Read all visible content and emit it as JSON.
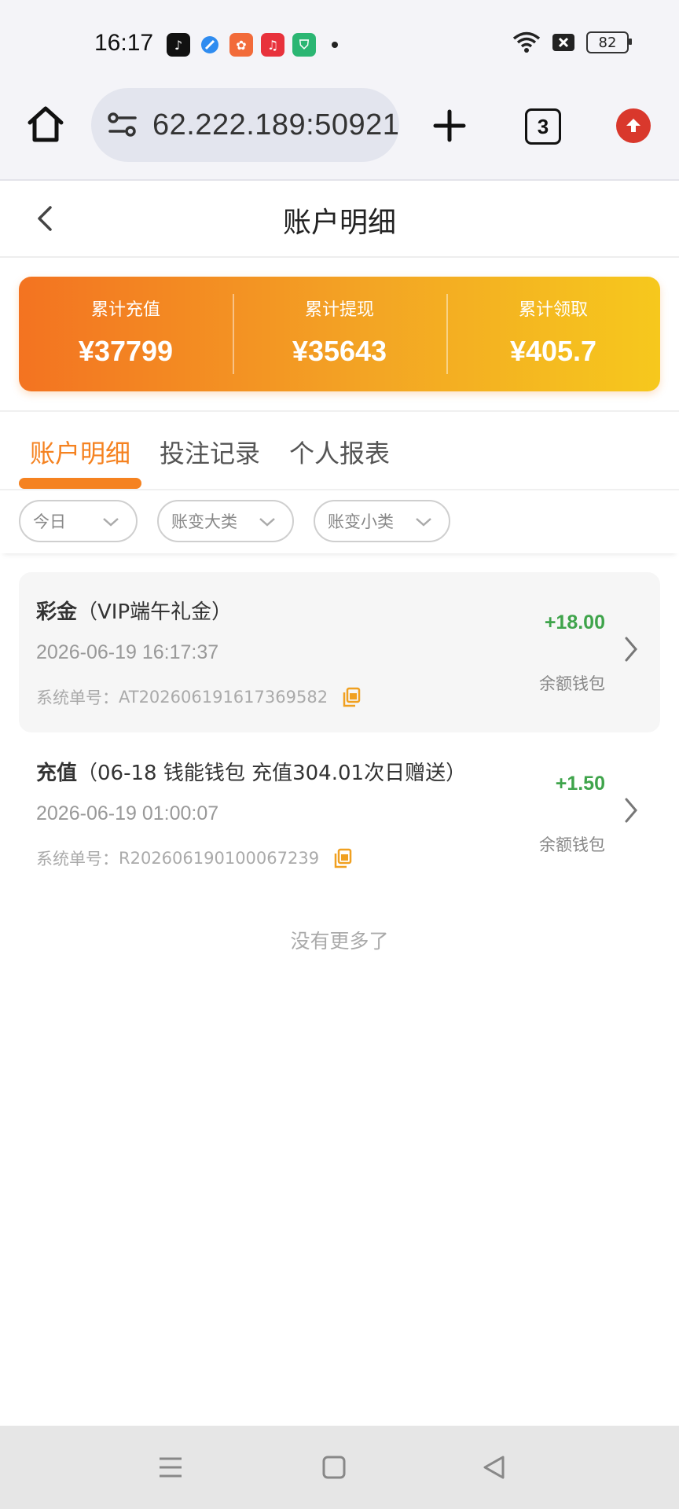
{
  "status_bar": {
    "time": "16:17",
    "battery": "82",
    "app_icons": [
      "tiktok-icon",
      "browser-icon",
      "game-icon",
      "music-icon",
      "shield-icon"
    ]
  },
  "browser": {
    "url": "62.222.189:50921",
    "tab_count": "3"
  },
  "header": {
    "title": "账户明细"
  },
  "summary": [
    {
      "label": "累计充值",
      "value": "¥37799"
    },
    {
      "label": "累计提现",
      "value": "¥35643"
    },
    {
      "label": "累计领取",
      "value": "¥405.7"
    }
  ],
  "tabs": [
    {
      "label": "账户明细",
      "active": true
    },
    {
      "label": "投注记录",
      "active": false
    },
    {
      "label": "个人报表",
      "active": false
    }
  ],
  "filters": [
    {
      "value": "今日"
    },
    {
      "value": "账变大类"
    },
    {
      "value": "账变小类"
    }
  ],
  "records": [
    {
      "type": "彩金",
      "note": "（VIP端午礼金）",
      "datetime": "2026-06-19 16:17:37",
      "order_label": "系统单号：",
      "order_no": "AT202606191617369582",
      "amount": "+18.00",
      "wallet": "余额钱包"
    },
    {
      "type": "充值",
      "note": "（06-18 钱能钱包 充值304.01次日赠送）",
      "datetime": "2026-06-19 01:00:07",
      "order_label": "系统单号：",
      "order_no": "R202606190100067239",
      "amount": "+1.50",
      "wallet": "余额钱包"
    }
  ],
  "footer_text": "没有更多了",
  "colors": {
    "accent": "#f58220",
    "positive": "#3fa44b",
    "gradient_start": "#f37321",
    "gradient_end": "#f6c81d"
  }
}
